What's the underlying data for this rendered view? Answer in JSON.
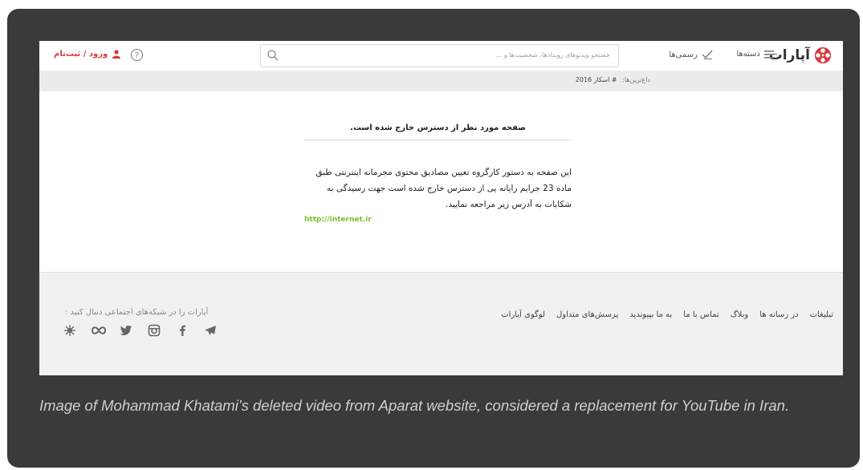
{
  "header": {
    "logo_text": "آپارات",
    "nav": [
      {
        "label": "دسته‌ها",
        "icon": "list-icon"
      },
      {
        "label": "رسمی‌ها",
        "icon": "verified-check-icon"
      }
    ],
    "search_placeholder": "جستجو ویدیوهای رویدادها، شخصیت‌ها و ...",
    "login_label": "ورود / ثبت‌نام",
    "login_icon": "user-icon",
    "help_icon": "help-circle-icon"
  },
  "subbar": {
    "label": "داغ‌ترین‌ها:",
    "tag": "# اسکار 2016"
  },
  "message": {
    "title": "صفحه مورد نظر از دسترس خارج شده است.",
    "body": "این صفحه به دستور کارگروه تعیین مصادیق محتوی مجرمانه اینترنتی طبق ماده 23 جرایم رایانه یی از دسترس خارج شده است جهت رسیدگی به شکایات به آدرس زیر مراجعه نمایید.",
    "link": "http://internet.ir"
  },
  "footer": {
    "links": [
      "تبلیغات",
      "در رسانه ها",
      "وبلاگ",
      "تماس با ما",
      "به ما بپیوندید",
      "پرسش‌های متداول",
      "لوگوی آپارات"
    ],
    "social_title": "آپارات را در شبکه‌های اجتماعی دنبال کنید :",
    "social_icons": [
      "telegram-icon",
      "facebook-icon",
      "instagram-icon",
      "twitter-icon",
      "infinity-icon",
      "cloud-icon"
    ]
  },
  "caption": "Image of Mohammad Khatami’s deleted video from Aparat website, considered a replacement for YouTube in Iran.",
  "colors": {
    "accent": "#d8383e",
    "link": "#7cbd2c",
    "card_bg": "#3a3a3a",
    "caption": "#cfcfcf"
  }
}
